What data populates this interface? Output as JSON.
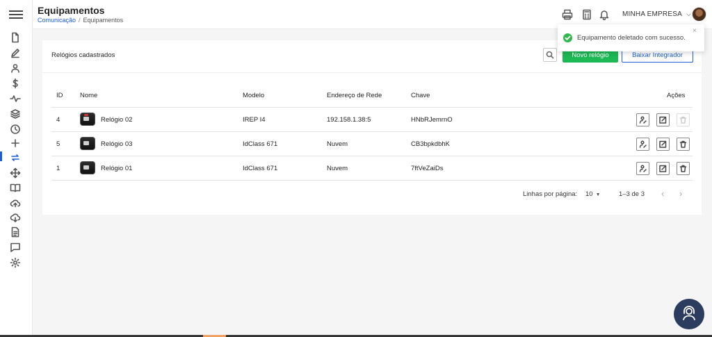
{
  "header": {
    "title": "Equipamentos",
    "breadcrumb": {
      "link": "Comunicação",
      "separator": "/",
      "current": "Equipamentos"
    },
    "company": "MINHA EMPRESA",
    "icons": [
      "printer-icon",
      "calculator-icon",
      "bell-icon"
    ]
  },
  "sidebar": {
    "items": [
      {
        "icon": "file-icon"
      },
      {
        "icon": "pencil-icon"
      },
      {
        "icon": "user-icon"
      },
      {
        "icon": "dollar-icon"
      },
      {
        "icon": "pulse-icon"
      },
      {
        "icon": "layers-icon"
      },
      {
        "icon": "clock-icon"
      },
      {
        "icon": "plus-icon"
      },
      {
        "icon": "sync-icon",
        "active": true
      },
      {
        "icon": "move-icon"
      },
      {
        "icon": "book-icon"
      },
      {
        "icon": "cloud-upload-icon"
      },
      {
        "icon": "cloud-download-icon"
      },
      {
        "icon": "document-icon"
      },
      {
        "icon": "chat-icon"
      },
      {
        "icon": "gear-icon"
      }
    ]
  },
  "main": {
    "card_title": "Relógios cadastrados",
    "new_button": "Novo relógio",
    "integrator_button": "Baixar Integrador",
    "columns": {
      "id": "ID",
      "name": "Nome",
      "model": "Modelo",
      "address": "Endereço de Rede",
      "key": "Chave",
      "actions": "Ações"
    },
    "rows": [
      {
        "id": "4",
        "name": "Relógio 02",
        "model": "IREP I4",
        "address": "192.158.1.38:5",
        "key": "HNbRJemrnO",
        "delete_enabled": false
      },
      {
        "id": "5",
        "name": "Relógio 03",
        "model": "IdClass 671",
        "address": "Nuvem",
        "key": "CB3bpkdbhK",
        "delete_enabled": true
      },
      {
        "id": "1",
        "name": "Relógio 01",
        "model": "IdClass 671",
        "address": "Nuvem",
        "key": "7ftVeZaiDs",
        "delete_enabled": true
      }
    ],
    "pagination": {
      "label": "Linhas por página:",
      "page_size": "10",
      "range": "1–3 de 3",
      "prev": "‹",
      "next": "›"
    }
  },
  "toast": {
    "message": "Equipamento deletado com sucesso.",
    "close": "×"
  },
  "colors": {
    "primary": "#1e5ed4",
    "success": "#1db954",
    "help_button": "#2b3c5f"
  }
}
